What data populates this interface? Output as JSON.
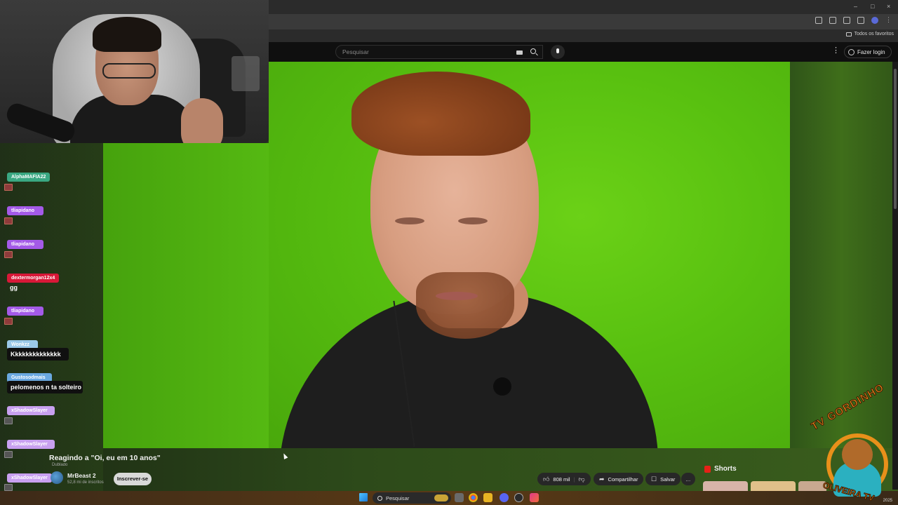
{
  "browser": {
    "window_controls": [
      "–",
      "□",
      "×"
    ],
    "bookmarks_label": "Todos os favoritos"
  },
  "youtube": {
    "search_placeholder": "Pesquisar",
    "login_label": "Fazer login",
    "video": {
      "title": "Reagindo a \"Oi, eu em 10 anos\"",
      "dub_label": "Dublado",
      "channel_name": "MrBeast 2",
      "subscribers": "52,8 mi de inscritos",
      "subscribe_label": "Inscrever-se",
      "likes": "808 mil",
      "share_label": "Compartilhar",
      "save_label": "Salvar",
      "more_label": "…"
    },
    "shorts_label": "Shorts"
  },
  "chat": {
    "messages": [
      {
        "user": "AlphaMAFIA22",
        "color": "#3aa882",
        "text": "",
        "emote": "red"
      },
      {
        "user": "tliapidano",
        "color": "#a45ae8",
        "text": "",
        "emote": "red"
      },
      {
        "user": "tliapidano",
        "color": "#a45ae8",
        "text": "",
        "emote": "red"
      },
      {
        "user": "dextermorgan12x4",
        "color": "#d81838",
        "text": "gg",
        "emote": ""
      },
      {
        "user": "tliapidano",
        "color": "#a45ae8",
        "text": "",
        "emote": "red"
      },
      {
        "user": "Wonkzz",
        "color": "#9ac8e8",
        "text": "Kkkkkkkkkkkkkk",
        "emote": ""
      },
      {
        "user": "Gustosodmais",
        "color": "#6aa8e0",
        "text": "pelomenos n ta solteiro",
        "emote": ""
      },
      {
        "user": "xShadowSlayer",
        "color": "#c8a0f0",
        "text": "",
        "emote": "gray"
      },
      {
        "user": "xShadowSlayer",
        "color": "#c8a0f0",
        "text": "",
        "emote": "gray"
      },
      {
        "user": "xShadowSlayer",
        "color": "#c8a0f0",
        "text": "",
        "emote": "gray"
      }
    ]
  },
  "taskbar": {
    "search_label": "Pesquisar",
    "time": "",
    "date": "2025"
  },
  "overlay_logo": {
    "top_text": "TV GORDINHO",
    "bottom_text": "OLIVEIRA TV"
  }
}
